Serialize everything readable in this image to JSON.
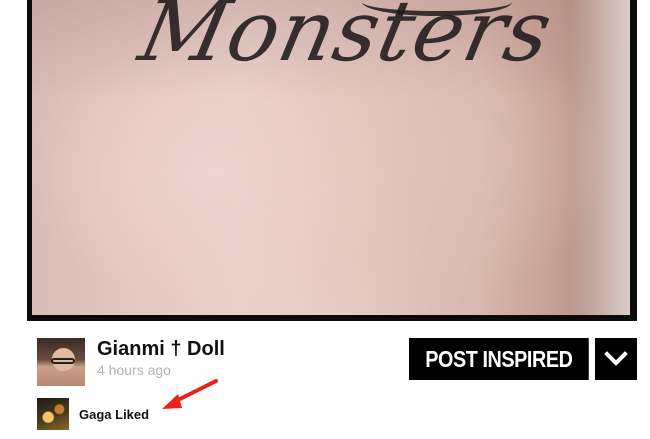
{
  "photo": {
    "tattoo_text": "Monsters"
  },
  "post": {
    "author": "Gianmi † Doll",
    "time": "4 hours ago"
  },
  "actions": {
    "inspired_label": "POST INSPIRED",
    "more_icon": "chevron-down-icon"
  },
  "liked": {
    "label": "Gaga Liked"
  },
  "annotation": {
    "arrow_color": "#e8221c"
  }
}
